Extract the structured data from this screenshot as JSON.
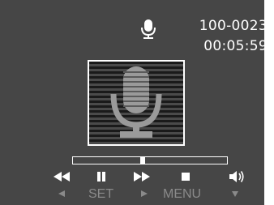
{
  "recording": {
    "file_number": "100-0023",
    "elapsed_time": "00:05:59",
    "progress": 0.45
  },
  "icons": {
    "status": "microphone-icon",
    "main": "microphone-icon",
    "controls": [
      "rewind-icon",
      "pause-icon",
      "fast-forward-icon",
      "stop-icon",
      "volume-icon"
    ],
    "hints": [
      "left-arrow-icon",
      "right-arrow-icon",
      "down-arrow-icon"
    ]
  },
  "button_hints": {
    "set_label": "SET",
    "menu_label": "MENU"
  },
  "colors": {
    "screen_bg": "#464646",
    "text": "#ffffff",
    "hint_text": "#8a8a8a",
    "mic_icon": "#9a9a9a"
  }
}
